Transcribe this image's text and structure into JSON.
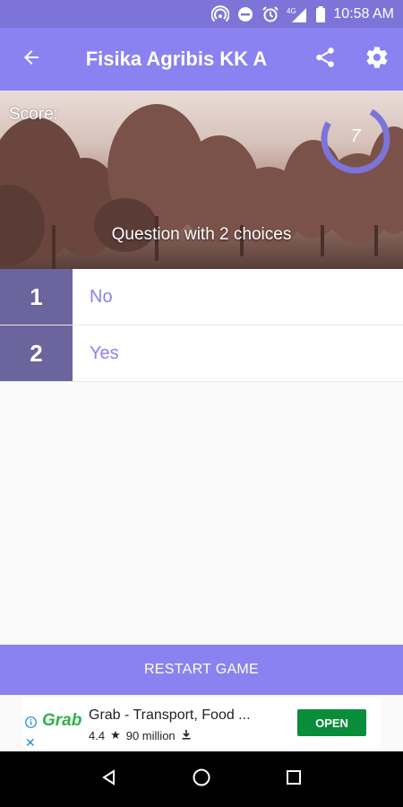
{
  "status_bar": {
    "time": "10:58 AM",
    "network": "4G",
    "icons": [
      "hotspot-icon",
      "dnd-icon",
      "alarm-icon",
      "signal-icon",
      "battery-icon"
    ]
  },
  "app_bar": {
    "title": "Fisika Agribis KK A",
    "icons": [
      "back-arrow-icon",
      "share-icon",
      "settings-icon"
    ]
  },
  "header": {
    "score_label": "Score:",
    "score_value": "7",
    "question": "Question with 2 choices"
  },
  "choices": [
    {
      "number": "1",
      "label": "No"
    },
    {
      "number": "2",
      "label": "Yes"
    }
  ],
  "restart_label": "RESTART GAME",
  "ad": {
    "brand": "Grab",
    "title": "Grab - Transport, Food ...",
    "rating": "4.4",
    "downloads": "90 million",
    "cta": "OPEN"
  },
  "colors": {
    "primary": "#8a82f0",
    "status_bar": "#7d74d8",
    "choice_number_bg": "#6c649c",
    "choice_text": "#8a82f0",
    "ad_cta": "#0a8d3b",
    "ad_brand": "#2fb24c"
  }
}
